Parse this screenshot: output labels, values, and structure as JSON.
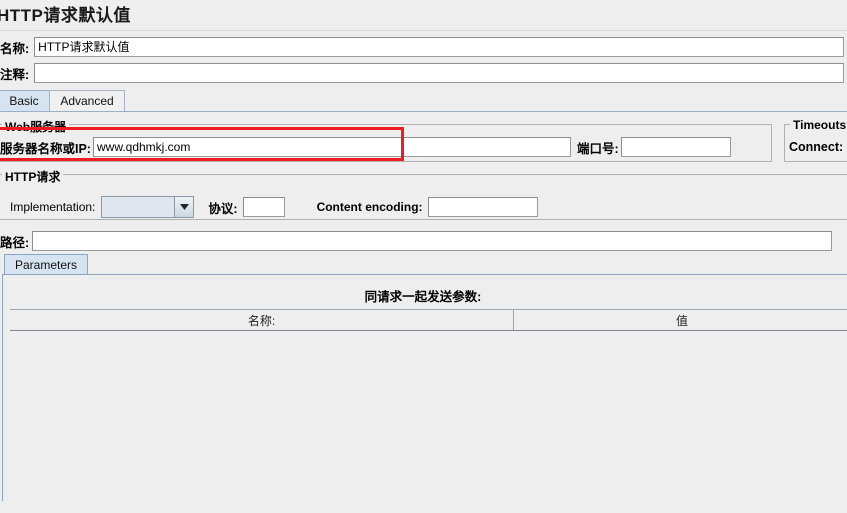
{
  "window": {
    "title": "HTTP请求默认值"
  },
  "form": {
    "name_label": "名称:",
    "name_value": "HTTP请求默认值",
    "comment_label": "注释:",
    "comment_value": ""
  },
  "main_tabs": [
    {
      "label": "Basic",
      "selected": true
    },
    {
      "label": "Advanced",
      "selected": false
    }
  ],
  "web_server": {
    "group_title": "Web服务器",
    "server_label": "服务器名称或IP:",
    "server_value": "www.qdhmkj.com",
    "port_label": "端口号:",
    "port_value": ""
  },
  "timeouts": {
    "group_title": "Timeouts (",
    "connect_label": "Connect:",
    "connect_value": ""
  },
  "http_request": {
    "group_title": "HTTP请求",
    "implementation_label": "Implementation:",
    "implementation_value": "",
    "protocol_label": "协议:",
    "protocol_value": "",
    "content_encoding_label": "Content encoding:",
    "content_encoding_value": "",
    "path_label": "路径:",
    "path_value": ""
  },
  "parameters": {
    "tab_label": "Parameters",
    "section_title": "同请求一起发送参数:",
    "columns": [
      "名称:",
      "值"
    ],
    "rows": []
  },
  "annotation": {
    "color": "#ec1c24"
  },
  "icons": {
    "combo_arrow": "chevron-down-icon"
  }
}
